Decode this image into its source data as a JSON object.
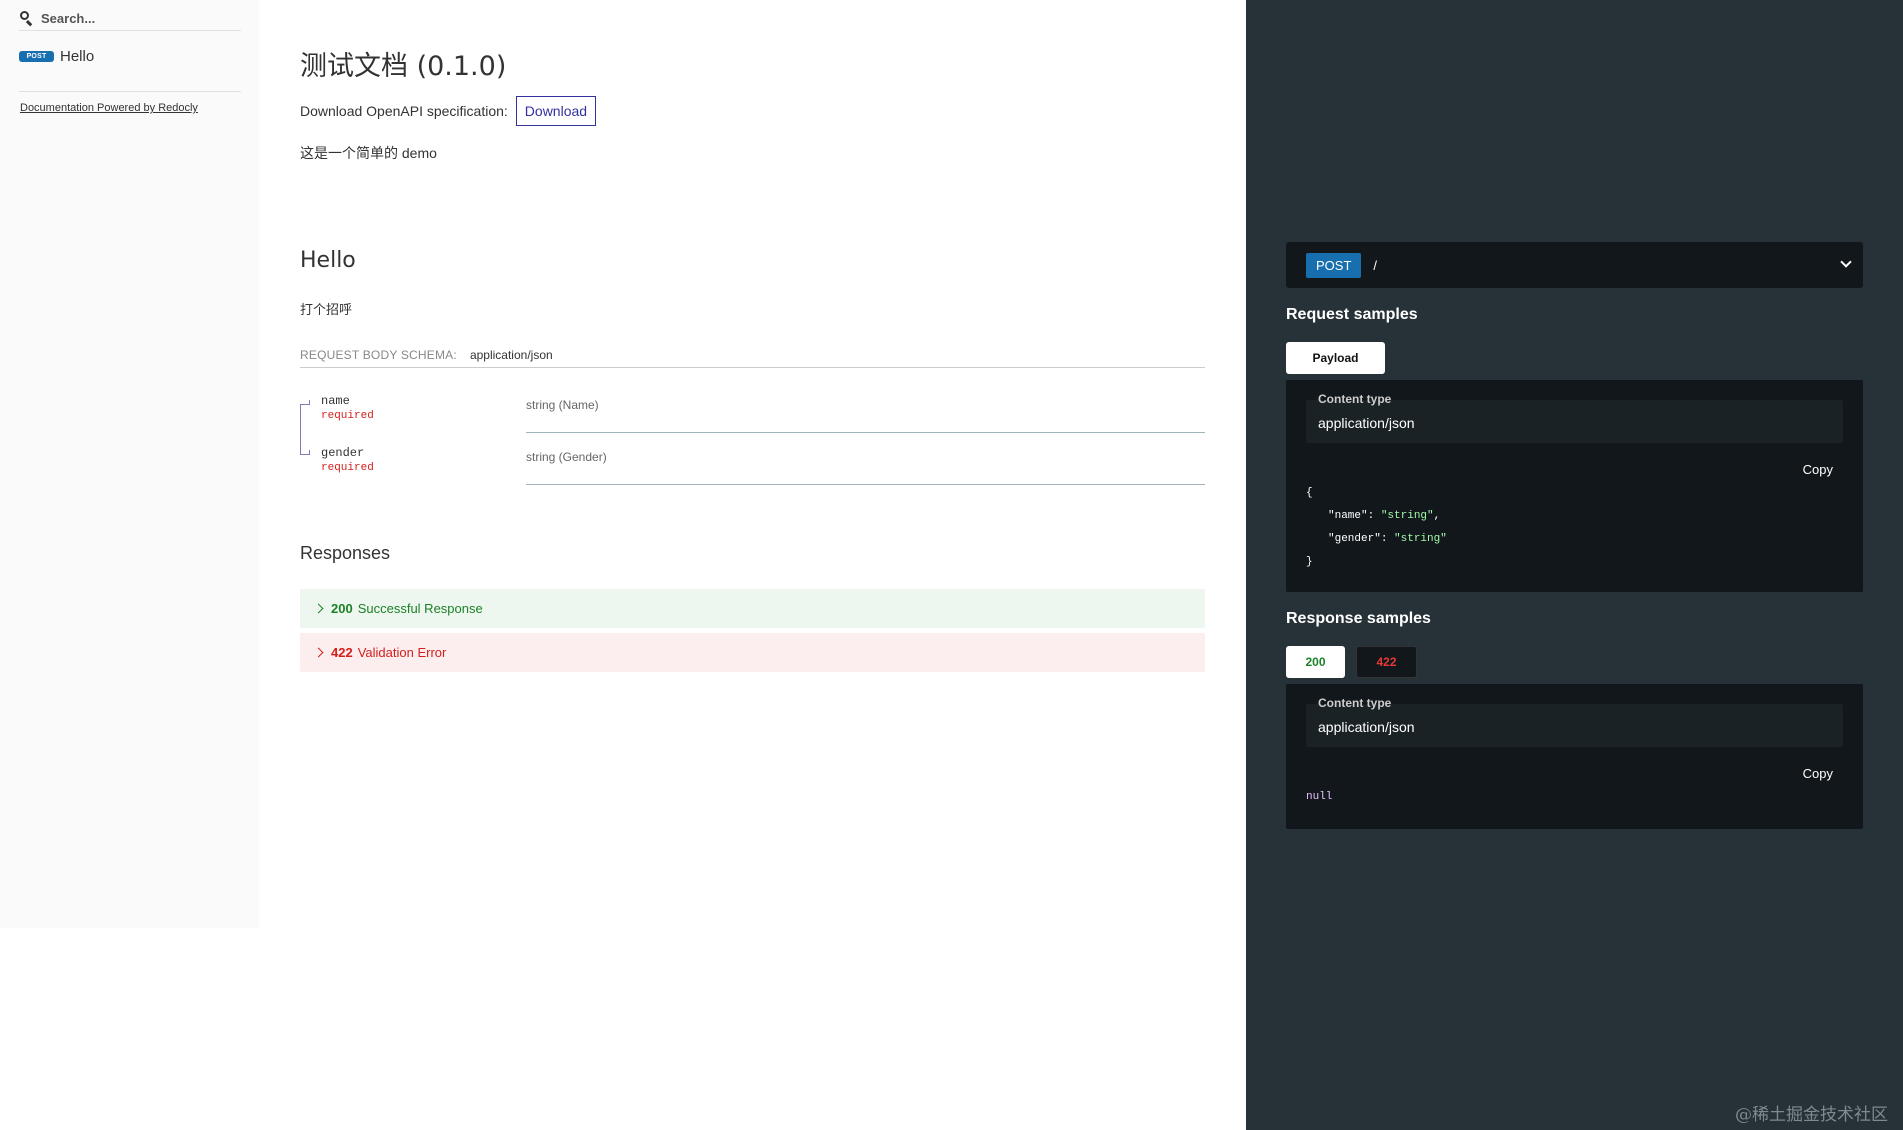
{
  "sidebar": {
    "search_placeholder": "Search...",
    "items": [
      {
        "method": "POST",
        "label": "Hello"
      }
    ],
    "powered_by": "Documentation Powered by Redocly"
  },
  "info": {
    "title": "测试文档 (0.1.0)",
    "download_label": "Download OpenAPI specification:",
    "download_button": "Download",
    "description": "这是一个简单的 demo"
  },
  "operation": {
    "title": "Hello",
    "description": "打个招呼",
    "request_body": {
      "label": "REQUEST BODY SCHEMA:",
      "content_type": "application/json",
      "properties": [
        {
          "name": "name",
          "required": "required",
          "type": "string (Name)"
        },
        {
          "name": "gender",
          "required": "required",
          "type": "string (Gender)"
        }
      ]
    },
    "responses_title": "Responses",
    "responses": [
      {
        "code": "200",
        "label": "Successful Response"
      },
      {
        "code": "422",
        "label": "Validation Error"
      }
    ]
  },
  "panel": {
    "method": "POST",
    "path": "/",
    "request_samples_title": "Request samples",
    "request_tab": "Payload",
    "content_type_label": "Content type",
    "content_type_value": "application/json",
    "copy_label": "Copy",
    "request_code": {
      "open": "{",
      "lines": [
        {
          "key": "\"name\"",
          "value": "\"string\"",
          "sep": ","
        },
        {
          "key": "\"gender\"",
          "value": "\"string\"",
          "sep": ""
        }
      ],
      "close": "}"
    },
    "response_samples_title": "Response samples",
    "response_tabs": [
      "200",
      "422"
    ],
    "response_code": "null"
  },
  "watermark": "@稀土掘金技术社区",
  "colors": {
    "post_badge": "#186faf",
    "success": "#1d8127",
    "error": "#d41f1c",
    "panel_bg": "#263238",
    "code_bg": "#11171a",
    "accent": "#32329f"
  }
}
